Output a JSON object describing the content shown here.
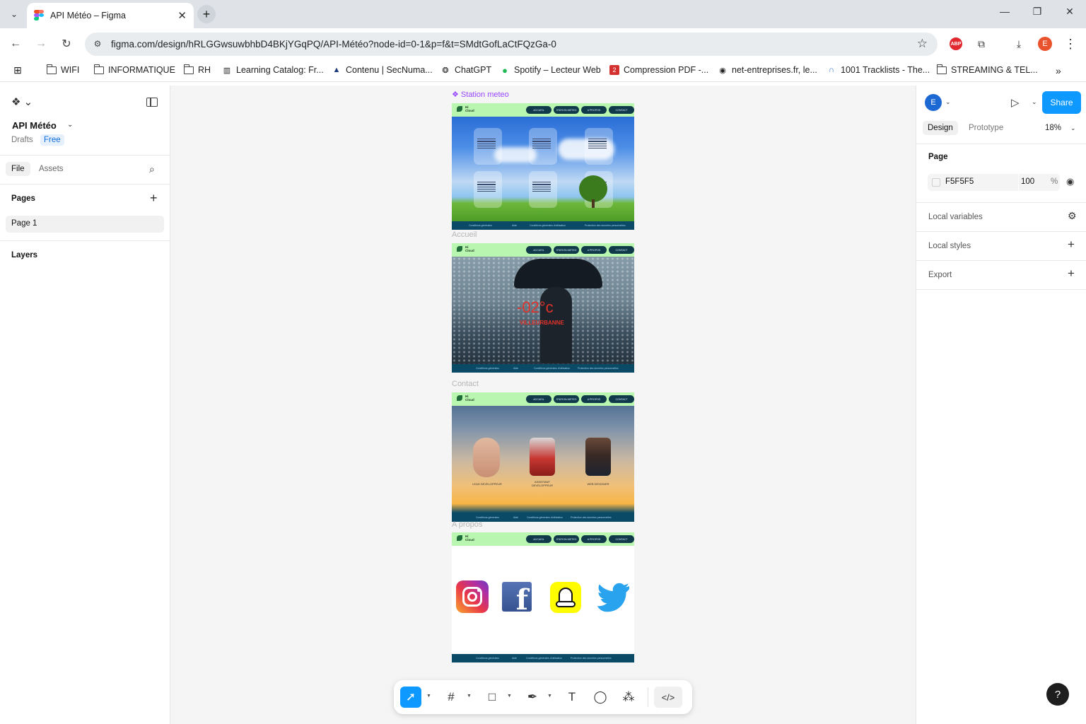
{
  "browser": {
    "tab_title": "API Météo – Figma",
    "url": "figma.com/design/hRLGGwsuwbhbD4BKjYGqPQ/API-Météo?node-id=0-1&p=f&t=SMdtGofLaCtFQzGa-0",
    "profile_initial": "E",
    "adblock_label": "ABP",
    "bookmarks": [
      {
        "label": "WIFI",
        "icon": "folder-icon"
      },
      {
        "label": "INFORMATIQUE",
        "icon": "folder-icon"
      },
      {
        "label": "RH",
        "icon": "folder-icon"
      },
      {
        "label": "Learning Catalog: Fr...",
        "icon": "learning-icon"
      },
      {
        "label": "Contenu | SecNuma...",
        "icon": "mortarboard-icon"
      },
      {
        "label": "ChatGPT",
        "icon": "openai-icon"
      },
      {
        "label": "Spotify – Lecteur Web",
        "icon": "spotify-icon"
      },
      {
        "label": "Compression PDF -...",
        "icon": "pdf-icon"
      },
      {
        "label": "net-entreprises.fr, le...",
        "icon": "globe-icon"
      },
      {
        "label": "1001 Tracklists - The...",
        "icon": "headphones-icon"
      },
      {
        "label": "STREAMING & TEL...",
        "icon": "folder-icon"
      }
    ]
  },
  "figma": {
    "file_name": "API Météo",
    "location": "Drafts",
    "plan_badge": "Free",
    "left_tabs": {
      "file": "File",
      "assets": "Assets"
    },
    "pages_heading": "Pages",
    "pages": [
      "Page 1"
    ],
    "layers_heading": "Layers",
    "right_panel": {
      "avatar_initial": "E",
      "share_label": "Share",
      "tabs": {
        "design": "Design",
        "prototype": "Prototype"
      },
      "zoom": "18%",
      "page_heading": "Page",
      "page_color": "F5F5F5",
      "page_opacity": "100",
      "opacity_unit": "%",
      "local_variables": "Local variables",
      "local_styles": "Local styles",
      "export": "Export"
    },
    "help_label": "?"
  },
  "canvas": {
    "frames": [
      {
        "label": "Station meteo",
        "selected": true
      },
      {
        "label": "Accueil",
        "selected": false
      },
      {
        "label": "Contact",
        "selected": false
      },
      {
        "label": "A propos",
        "selected": false
      }
    ],
    "site": {
      "logo_text": "Hi\nCloud",
      "nav": [
        "ACCUEIL",
        "STATION METEO",
        "A PROPOS",
        "CONTACT"
      ],
      "footer": [
        "Conditions générales",
        "Aide",
        "Conditions générales d'utilisation",
        "Protection des données personnelles"
      ]
    },
    "accueil": {
      "temperature": "-02°c",
      "city": "VILLEURBANNE"
    },
    "contact_team": [
      "LEAD DEVELOPPEUR",
      "ASSISTANT\nDEVELOPPEUR",
      "WEB DESIGNER"
    ],
    "social_icons": [
      "instagram-icon",
      "facebook-icon",
      "snapchat-icon",
      "twitter-icon"
    ]
  },
  "colors": {
    "figma_blue": "#0d99ff",
    "frame_header": "#b9f7b0",
    "frame_footer": "#0b4a66",
    "selection_purple": "#9747ff"
  }
}
